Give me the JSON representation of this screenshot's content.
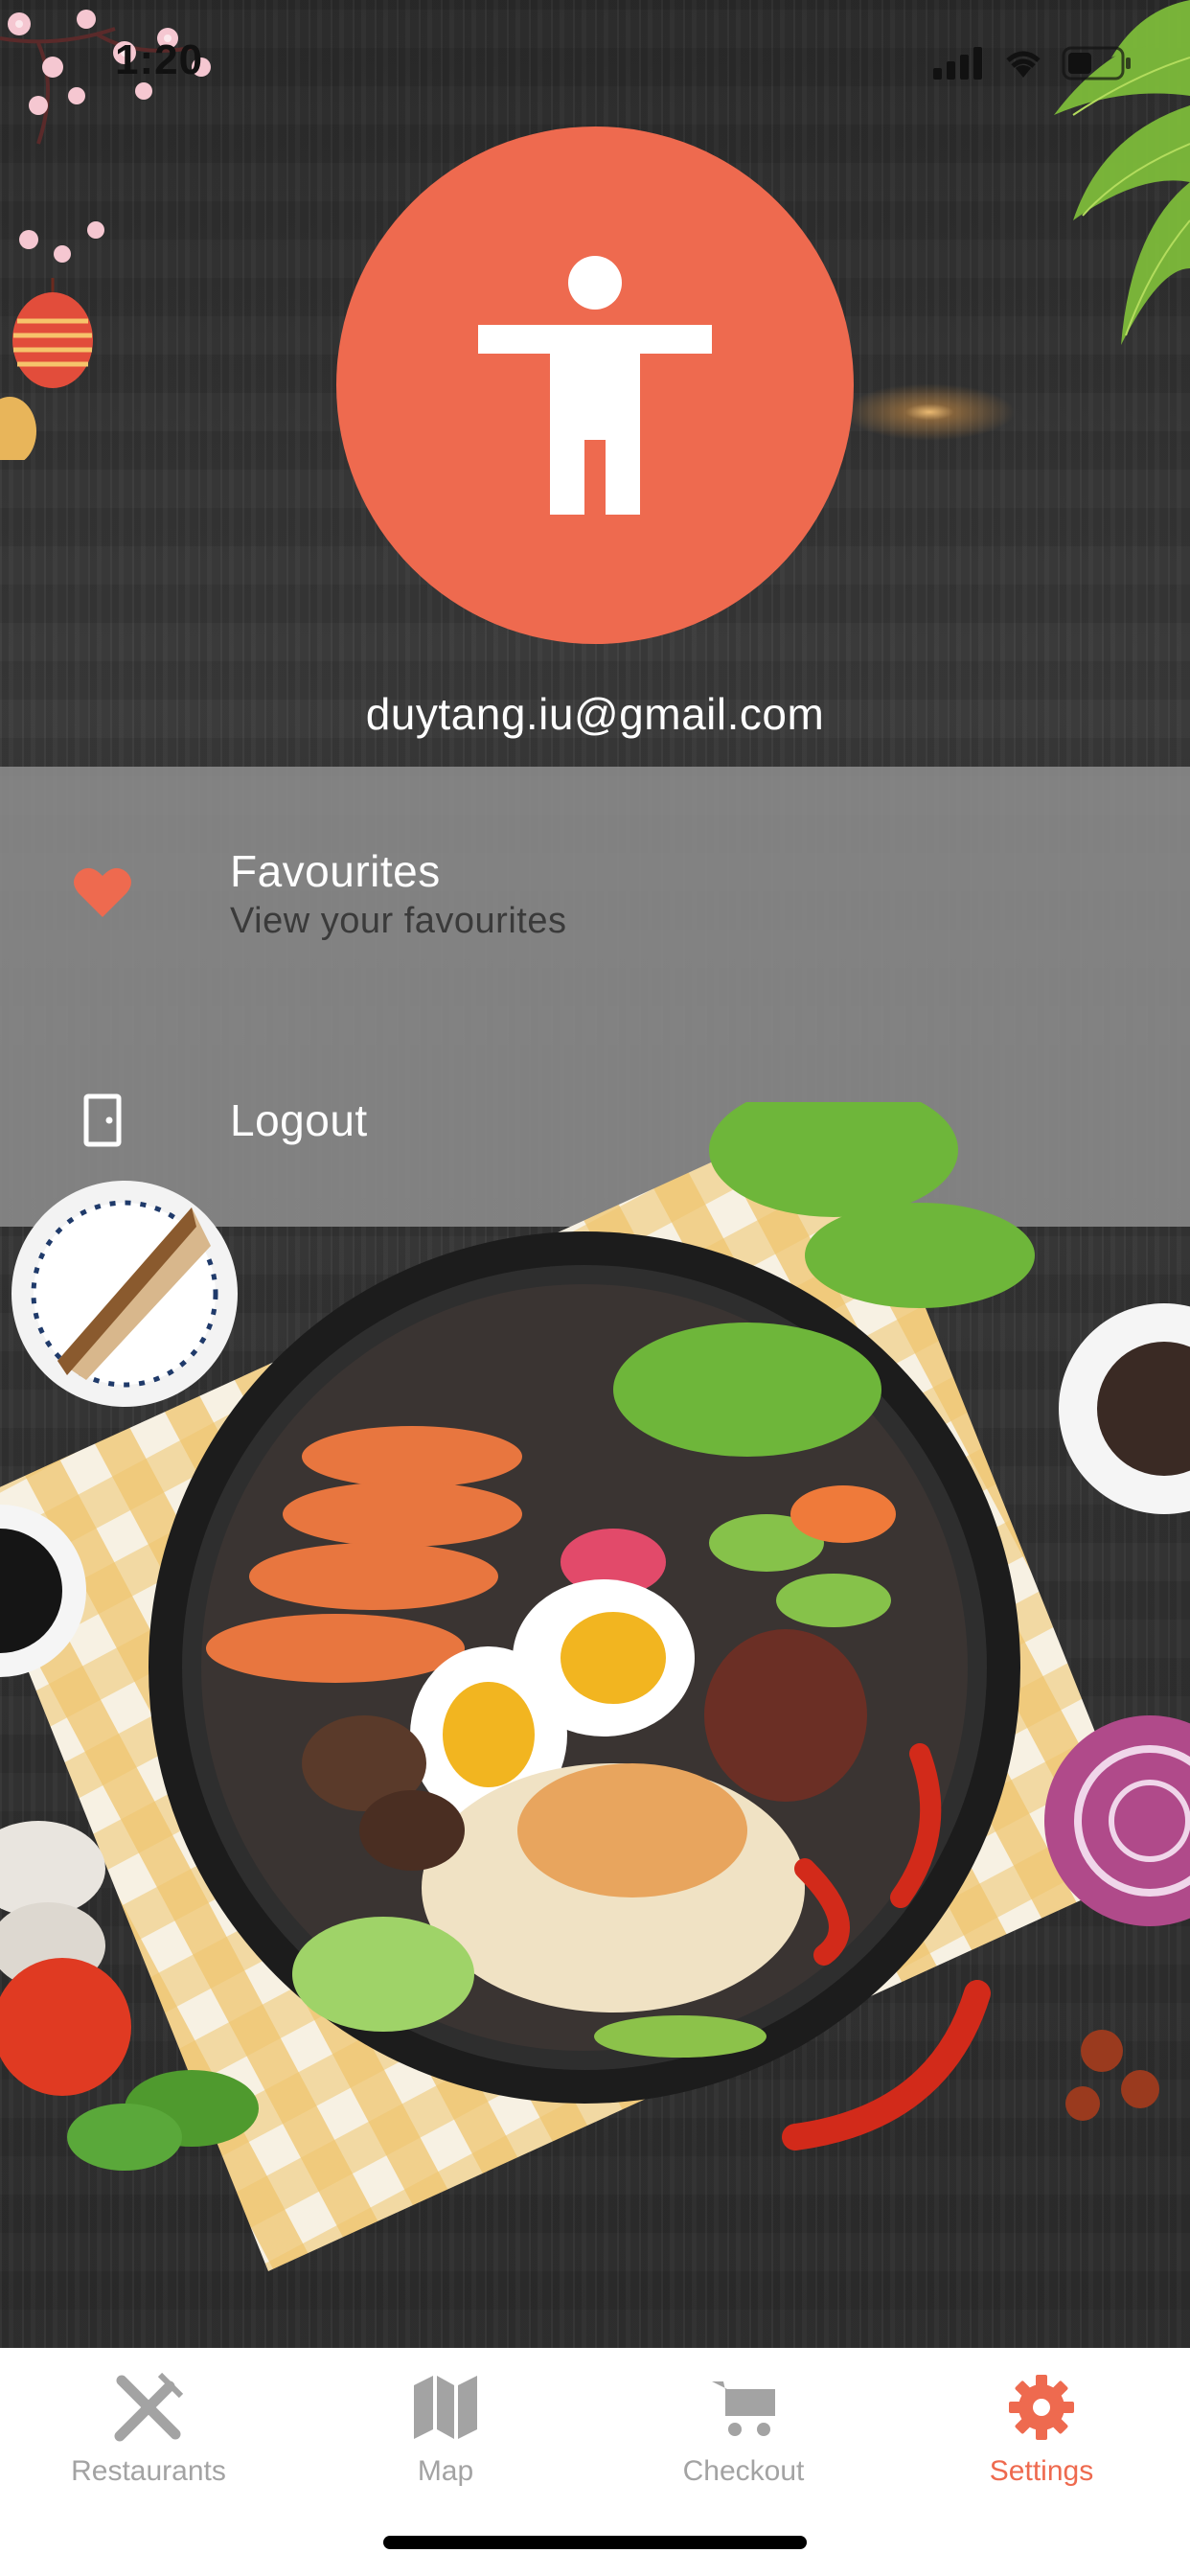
{
  "status_bar": {
    "time": "1:20"
  },
  "profile": {
    "avatar_icon": "accessibility-person-icon",
    "email": "duytang.iu@gmail.com"
  },
  "menu": {
    "items": [
      {
        "title": "Favourites",
        "subtitle": "View your favourites",
        "icon": "heart-icon"
      },
      {
        "title": "Logout",
        "icon": "door-icon"
      }
    ]
  },
  "tab_bar": {
    "tabs": [
      {
        "label": "Restaurants",
        "icon": "fork-knife-icon",
        "active": false
      },
      {
        "label": "Map",
        "icon": "map-icon",
        "active": false
      },
      {
        "label": "Checkout",
        "icon": "cart-icon",
        "active": false
      },
      {
        "label": "Settings",
        "icon": "gear-icon",
        "active": true
      }
    ]
  },
  "colors": {
    "accent": "#ee6a4f",
    "tab_inactive": "#a3a3a3",
    "menu_overlay": "#8c8c8c",
    "subtitle_text": "#3a3a3a"
  }
}
